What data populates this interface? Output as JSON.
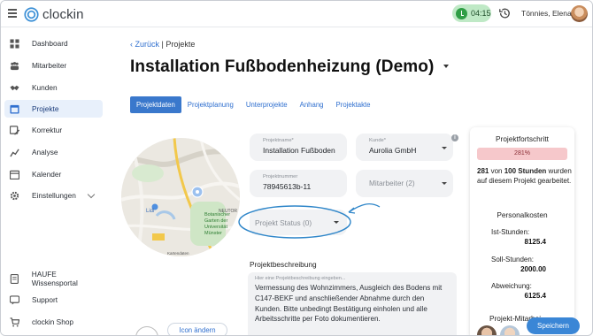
{
  "app": {
    "name": "clockin"
  },
  "topbar": {
    "timer": "04:15",
    "user_name": "Tönnies, Elena",
    "icons": {
      "menu": "hamburger-icon",
      "history": "history-icon",
      "timer": "clock-icon"
    },
    "timer_color": "#bfe9c6"
  },
  "sidebar": {
    "items": [
      {
        "label": "Dashboard",
        "icon": "dashboard-icon"
      },
      {
        "label": "Mitarbeiter",
        "icon": "users-icon"
      },
      {
        "label": "Kunden",
        "icon": "handshake-icon"
      },
      {
        "label": "Projekte",
        "icon": "calendar-grid-icon",
        "active": true
      },
      {
        "label": "Korrektur",
        "icon": "calendar-edit-icon"
      },
      {
        "label": "Analyse",
        "icon": "chart-icon"
      },
      {
        "label": "Kalender",
        "icon": "calendar-icon"
      },
      {
        "label": "Einstellungen",
        "icon": "gear-icon"
      }
    ],
    "bottom_items": [
      {
        "label": "HAUFE Wissensportal",
        "icon": "book-icon"
      },
      {
        "label": "Support",
        "icon": "support-icon"
      },
      {
        "label": "clockin Shop",
        "icon": "cart-icon"
      }
    ]
  },
  "breadcrumb": {
    "back": "Zurück",
    "separator": "|",
    "current": "Projekte"
  },
  "page": {
    "title": "Installation Fußbodenheizung (Demo)"
  },
  "tabs": [
    {
      "label": "Projektdaten",
      "active": true
    },
    {
      "label": "Projektplanung"
    },
    {
      "label": "Unterprojekte"
    },
    {
      "label": "Anhang"
    },
    {
      "label": "Projektakte"
    }
  ],
  "map": {
    "labels": [
      "NEUTOR",
      "Lidl",
      "Botanischer",
      "Garten der",
      "Universität",
      "Münster",
      "Kartendaten"
    ]
  },
  "form": {
    "project_name": {
      "label": "Projektname*",
      "value": "Installation Fußboden"
    },
    "customer": {
      "label": "Kunde*",
      "value": "Aurolia GmbH"
    },
    "project_number": {
      "label": "Projektnummer",
      "value": "78945613b-11"
    },
    "employees": {
      "placeholder": "Mitarbeiter (2)"
    },
    "status": {
      "placeholder": "Projekt Status (0)"
    },
    "icon_change": "Icon ändern"
  },
  "description": {
    "title": "Projektbeschreibung",
    "label": "Hier eine Projektbeschreibung eingeben...",
    "text": "Vermessung des Wohnzimmers, Ausgleich des Bodens mit C147-BEKF und anschließender Abnahme durch den Kunden. Bitte unbedingt Bestätigung einholen und alle Arbeitsschritte per Foto dokumentieren."
  },
  "progress_panel": {
    "title": "Projektfortschritt",
    "percent_label": "281%",
    "percent_value": 281,
    "hours_done": "281",
    "hours_of": "von",
    "hours_total": "100 Stunden",
    "hours_suffix": "wurden auf diesem Projekt gearbeitet.",
    "costs_title": "Personalkosten",
    "ist_label": "Ist-Stunden:",
    "ist_value": "8125.4",
    "soll_label": "Soll-Stunden:",
    "soll_value": "2000.00",
    "abw_label": "Abweichung:",
    "abw_value": "6125.4",
    "team_title": "Projekt-Mitarbei",
    "bar_color": "#f6c8cb"
  },
  "actions": {
    "save": "Speichern"
  },
  "colors": {
    "accent": "#3a78cc",
    "link": "#2f6fcf",
    "annotation": "#2f86c9"
  }
}
